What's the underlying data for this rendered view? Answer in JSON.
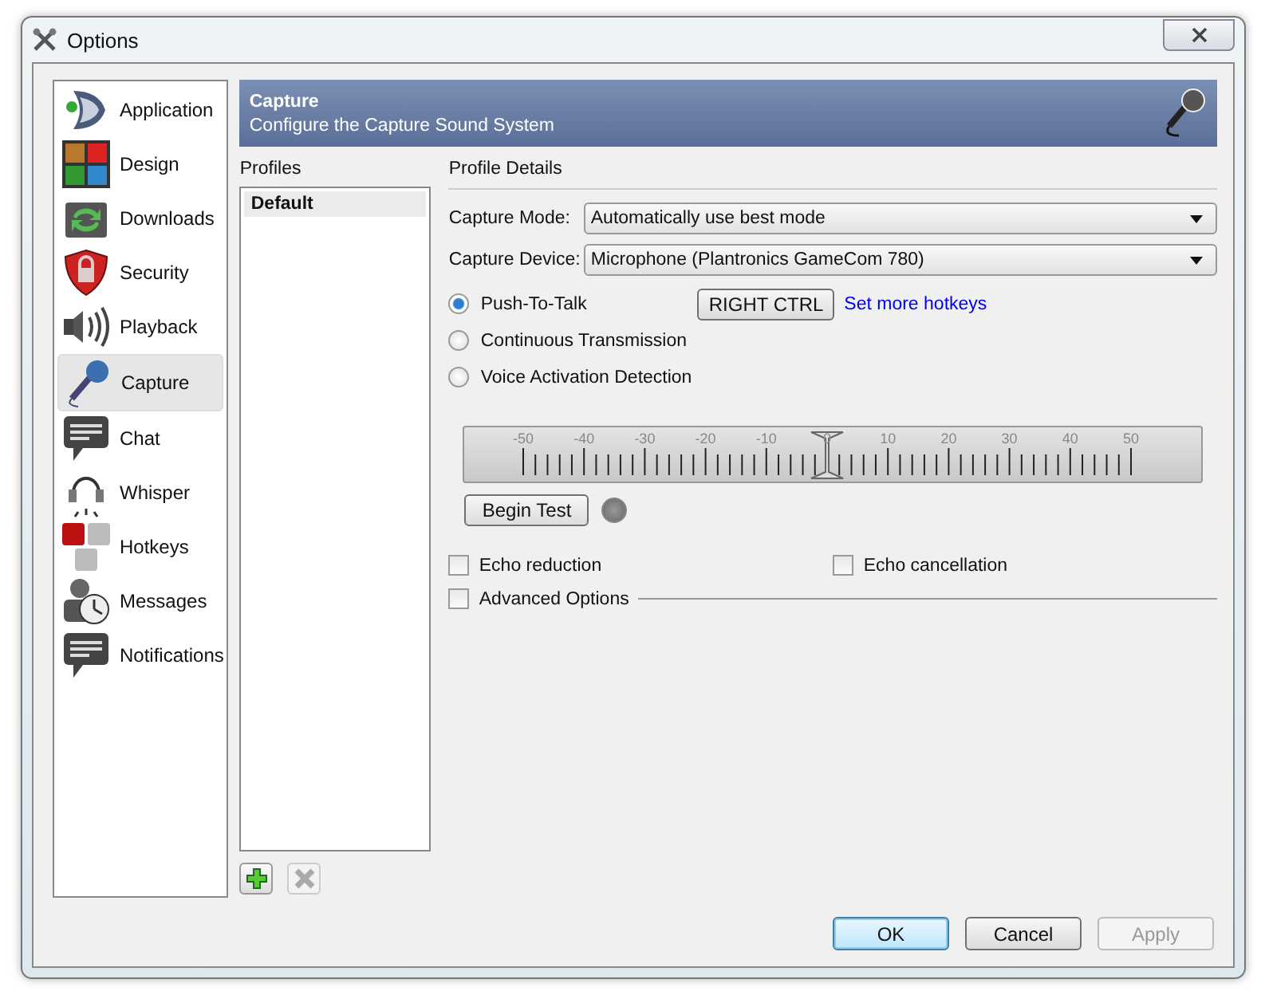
{
  "window": {
    "title": "Options"
  },
  "sidebar": {
    "items": [
      {
        "label": "Application",
        "kind": "app",
        "selected": false
      },
      {
        "label": "Design",
        "kind": "design",
        "selected": false
      },
      {
        "label": "Downloads",
        "kind": "downloads",
        "selected": false
      },
      {
        "label": "Security",
        "kind": "security",
        "selected": false
      },
      {
        "label": "Playback",
        "kind": "playback",
        "selected": false
      },
      {
        "label": "Capture",
        "kind": "capture",
        "selected": true
      },
      {
        "label": "Chat",
        "kind": "chat",
        "selected": false
      },
      {
        "label": "Whisper",
        "kind": "whisper",
        "selected": false
      },
      {
        "label": "Hotkeys",
        "kind": "hotkeys",
        "selected": false
      },
      {
        "label": "Messages",
        "kind": "messages",
        "selected": false
      },
      {
        "label": "Notifications",
        "kind": "chat",
        "selected": false
      }
    ]
  },
  "header": {
    "title": "Capture",
    "subtitle": "Configure the Capture Sound System"
  },
  "profiles": {
    "label": "Profiles",
    "items": [
      {
        "label": "Default",
        "selected": true
      }
    ],
    "remove_disabled": true
  },
  "details": {
    "label": "Profile Details",
    "capture_mode": {
      "label": "Capture Mode:",
      "value": "Automatically use best mode"
    },
    "capture_device": {
      "label": "Capture Device:",
      "value": "Microphone (Plantronics GameCom 780)"
    },
    "modes": [
      {
        "label": "Push-To-Talk",
        "selected": true
      },
      {
        "label": "Continuous Transmission",
        "selected": false
      },
      {
        "label": "Voice Activation Detection",
        "selected": false
      }
    ],
    "hotkey": "RIGHT CTRL",
    "hotkey_link": "Set more hotkeys",
    "threshold": {
      "labels": [
        "-50",
        "-40",
        "-30",
        "-20",
        "-10",
        "0",
        "10",
        "20",
        "30",
        "40",
        "50"
      ],
      "level": 0.5
    },
    "begin_test": "Begin Test",
    "test_led": {
      "on": false
    },
    "options": [
      {
        "label": "Echo reduction",
        "checked": false
      },
      {
        "label": "Echo cancellation",
        "checked": false
      }
    ],
    "advanced": {
      "label": "Advanced Options",
      "checked": false
    }
  },
  "buttons": [
    {
      "label": "OK",
      "default": true,
      "disabled": false
    },
    {
      "label": "Cancel",
      "default": false,
      "disabled": false
    },
    {
      "label": "Apply",
      "default": false,
      "disabled": true
    }
  ]
}
